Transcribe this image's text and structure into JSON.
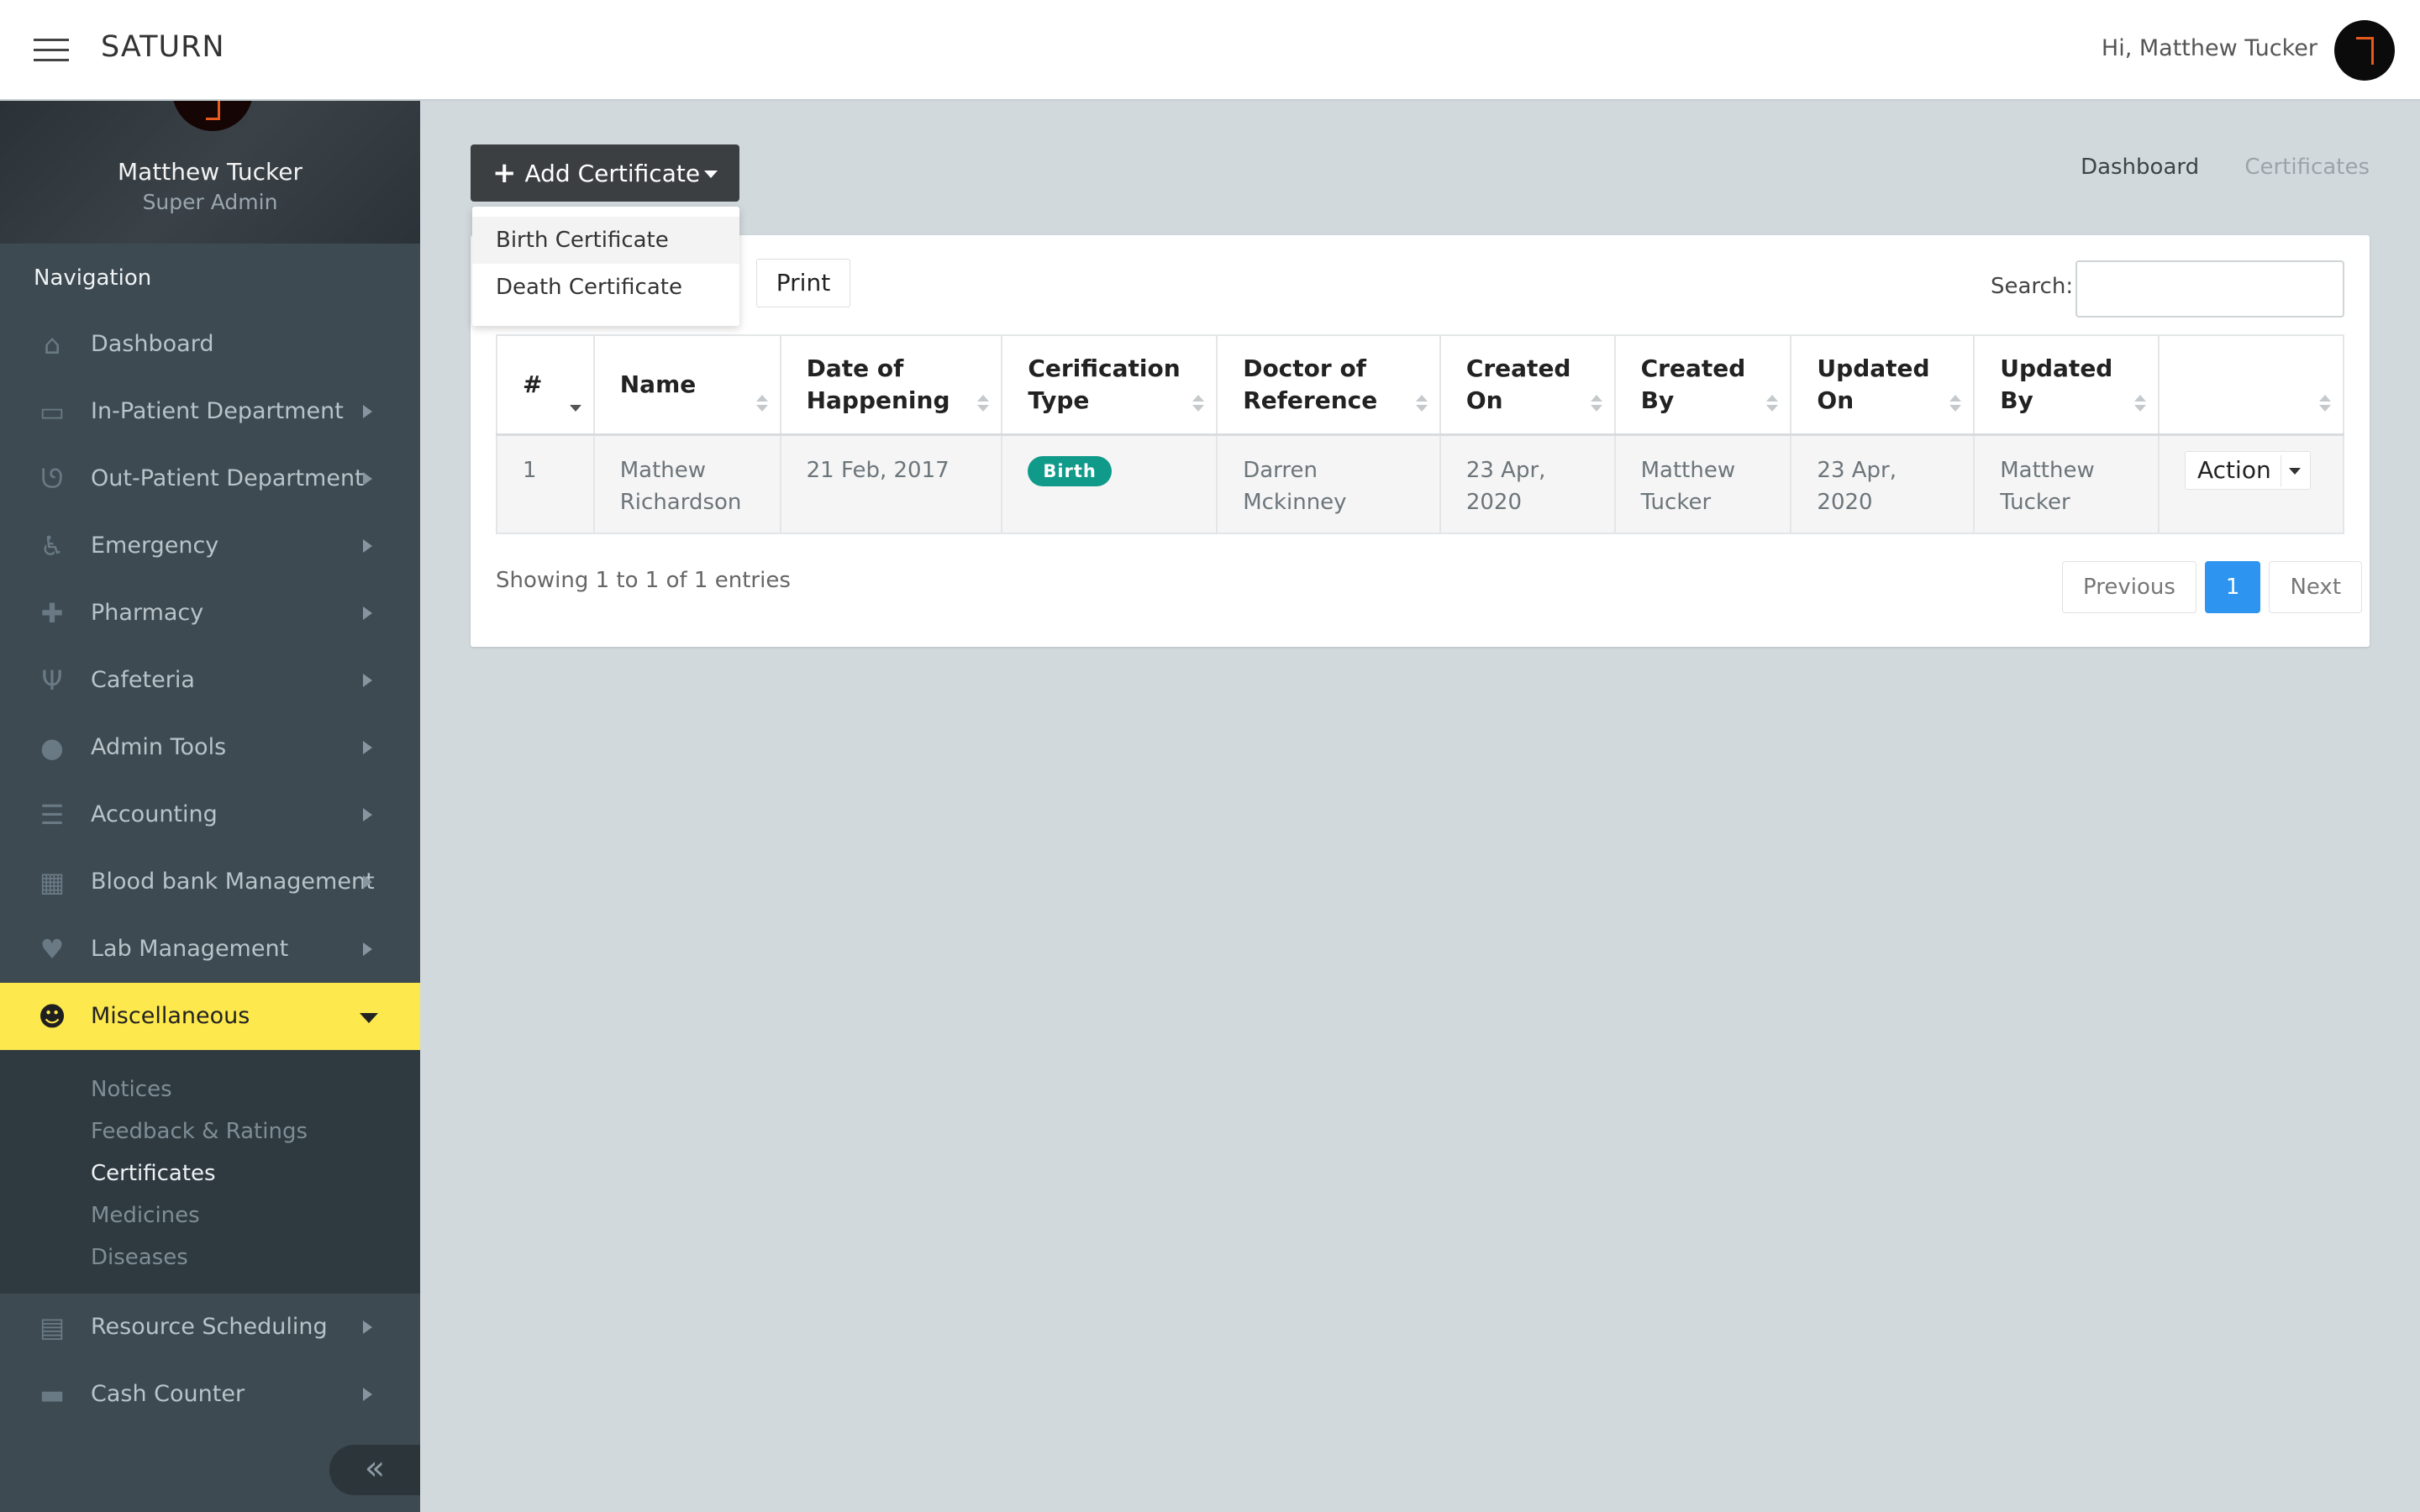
{
  "app": {
    "title": "SATURN",
    "greeting": "Hi, Matthew Tucker"
  },
  "profile": {
    "name": "Matthew Tucker",
    "role": "Super Admin"
  },
  "sidebar": {
    "heading": "Navigation",
    "items": [
      {
        "label": "Dashboard",
        "icon": "home-icon",
        "glyph": "⌂",
        "has_children": false
      },
      {
        "label": "In-Patient Department",
        "icon": "bed-icon",
        "glyph": "▭",
        "has_children": true
      },
      {
        "label": "Out-Patient Department",
        "icon": "stethoscope-icon",
        "glyph": "ᘎ",
        "has_children": true
      },
      {
        "label": "Emergency",
        "icon": "wheelchair-icon",
        "glyph": "♿",
        "has_children": true
      },
      {
        "label": "Pharmacy",
        "icon": "medkit-icon",
        "glyph": "✚",
        "has_children": true
      },
      {
        "label": "Cafeteria",
        "icon": "utensils-icon",
        "glyph": "Ψ",
        "has_children": true
      },
      {
        "label": "Admin Tools",
        "icon": "user-icon",
        "glyph": "●",
        "has_children": true
      },
      {
        "label": "Accounting",
        "icon": "list-icon",
        "glyph": "☰",
        "has_children": true
      },
      {
        "label": "Blood bank Management",
        "icon": "hospital-icon",
        "glyph": "▦",
        "has_children": true
      },
      {
        "label": "Lab Management",
        "icon": "heartbeat-icon",
        "glyph": "♥",
        "has_children": true
      },
      {
        "label": "Miscellaneous",
        "icon": "user-md-icon",
        "glyph": "☻",
        "has_children": true,
        "active": true
      }
    ],
    "submenu": [
      {
        "label": "Notices"
      },
      {
        "label": "Feedback & Ratings"
      },
      {
        "label": "Certificates",
        "current": true
      },
      {
        "label": "Medicines"
      },
      {
        "label": "Diseases"
      }
    ],
    "after_items": [
      {
        "label": "Resource Scheduling",
        "icon": "calendar-icon",
        "glyph": "▤",
        "has_children": true
      },
      {
        "label": "Cash Counter",
        "icon": "money-icon",
        "glyph": "▬",
        "has_children": true
      }
    ],
    "collapse_glyph": "«"
  },
  "toolbar": {
    "add_label": "Add Certificate",
    "dropdown": [
      "Birth Certificate",
      "Death Certificate"
    ],
    "print_label": "Print",
    "search_label": "Search:",
    "search_value": ""
  },
  "breadcrumb": [
    "Dashboard",
    "Certificates"
  ],
  "table": {
    "headers": [
      "#",
      "Name",
      "Date of Happening",
      "Cerification Type",
      "Doctor of Reference",
      "Created On",
      "Created By",
      "Updated On",
      "Updated By",
      ""
    ],
    "rows": [
      {
        "num": "1",
        "name": "Mathew Richardson",
        "date": "21 Feb, 2017",
        "type": "Birth",
        "doctor": "Darren Mckinney",
        "created_on": "23 Apr, 2020",
        "created_by": "Matthew Tucker",
        "updated_on": "23 Apr, 2020",
        "updated_by": "Matthew Tucker",
        "action": "Action"
      }
    ]
  },
  "footer": {
    "showing": "Showing 1 to 1 of 1 entries",
    "previous": "Previous",
    "page": "1",
    "next": "Next"
  },
  "colors": {
    "accent_yellow": "#fde84d",
    "badge_teal": "#0f9a8a",
    "page_active": "#2d95f0",
    "sidebar_bg": "#3d4a52"
  }
}
